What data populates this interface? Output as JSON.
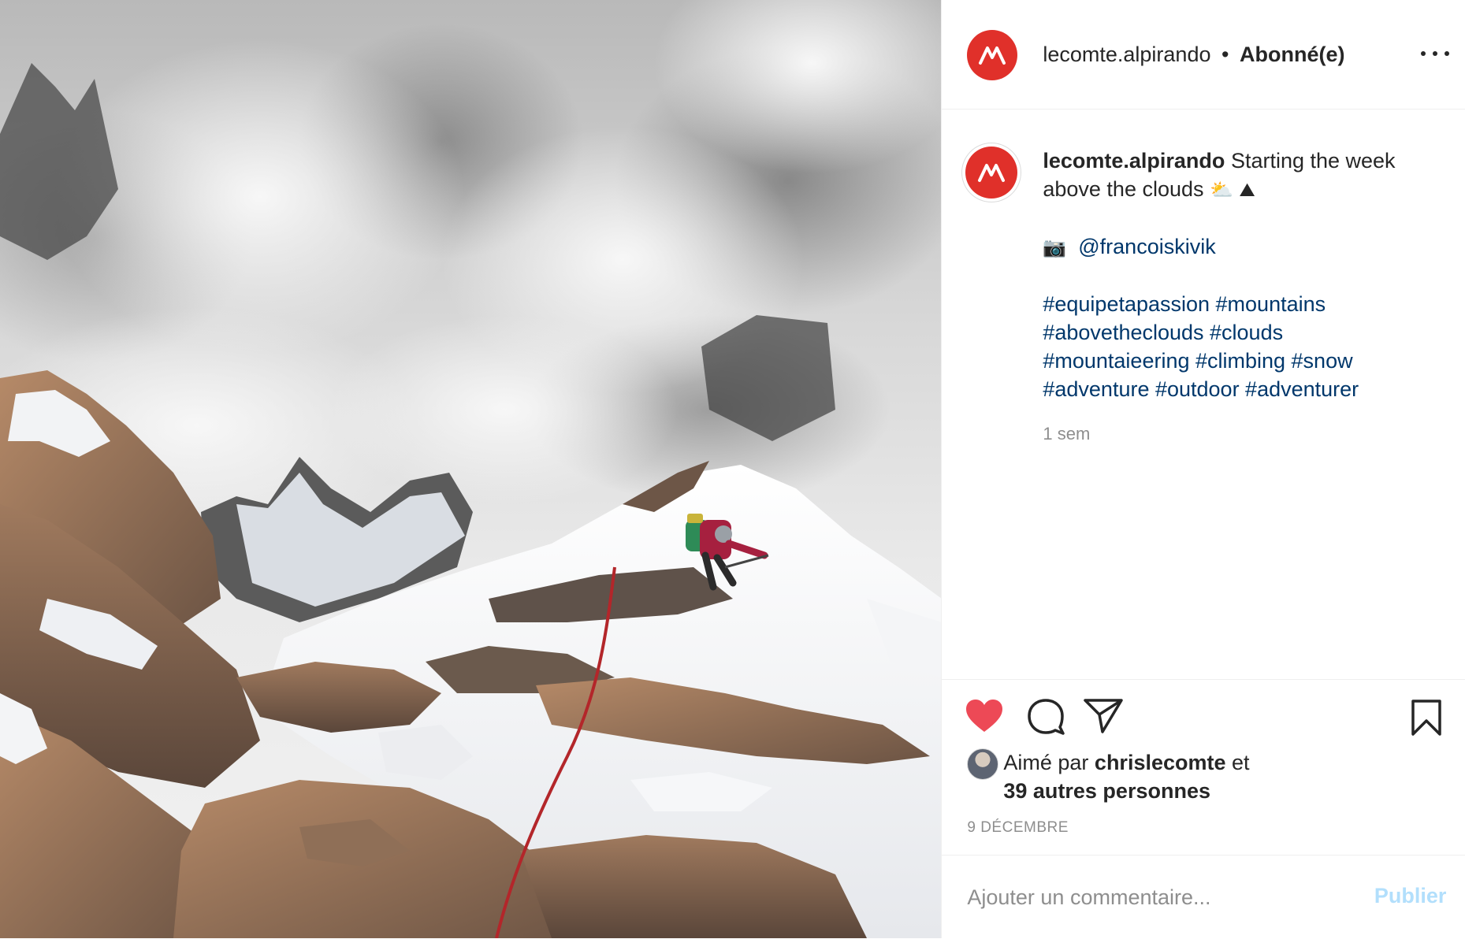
{
  "photo": {
    "alt_icon": "mountain-climber-photo"
  },
  "header": {
    "username": "lecomte.alpirando",
    "separator": "•",
    "follow_status": "Abonné(e)",
    "more_icon": "more-horizontal-icon"
  },
  "caption": {
    "username": "lecomte.alpirando",
    "text_line1": "Starting the week",
    "text_line2": "above the clouds",
    "emoji1": "⛅",
    "emoji2": "⛰",
    "camera_emoji": "📷",
    "mention": "@francoiskivik",
    "hashtags": [
      "#equipetapassion #mountains",
      "#abovetheclouds #clouds",
      "#mountaieering #climbing #snow",
      "#adventure #outdoor #adventurer"
    ],
    "time_ago": "1 sem"
  },
  "actions": {
    "like_icon": "heart-filled-icon",
    "comment_icon": "comment-icon",
    "share_icon": "send-icon",
    "save_icon": "bookmark-icon",
    "like_color": "#ed4956"
  },
  "likes": {
    "prefix": "Aimé par",
    "user": "chrislecomte",
    "suffix": "et",
    "others": "39 autres personnes"
  },
  "date": "9 DÉCEMBRE",
  "comment": {
    "placeholder": "Ajouter un commentaire...",
    "publish_label": "Publier"
  },
  "colors": {
    "brand_red": "#e0302a",
    "link_blue": "#00376b",
    "muted": "#8e8e8e",
    "publish_disabled": "#b2dffc"
  }
}
